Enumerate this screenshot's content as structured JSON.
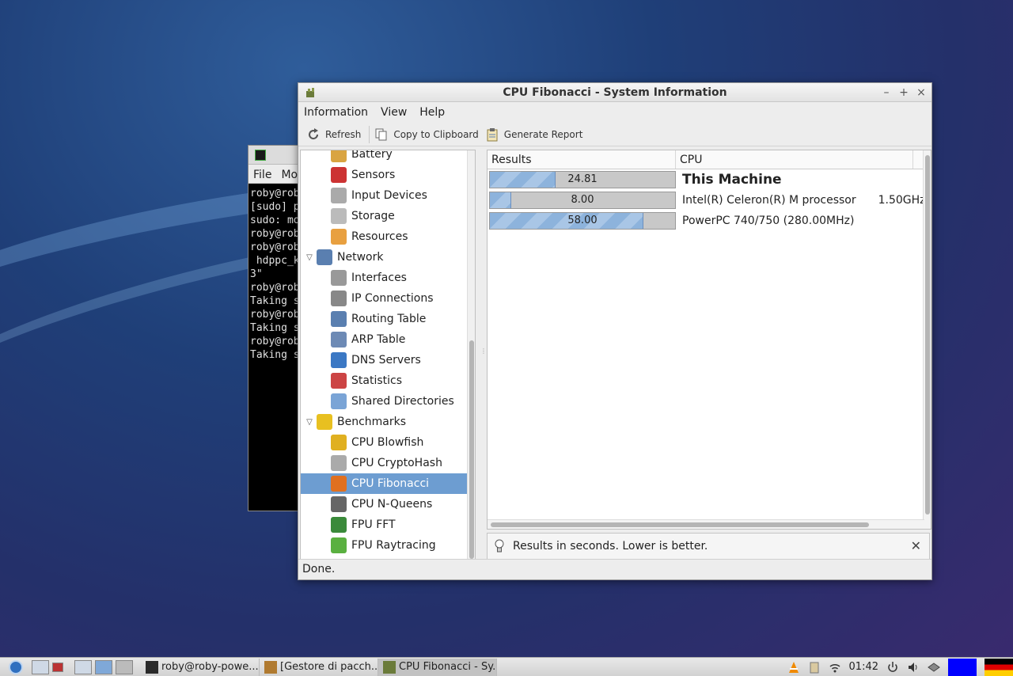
{
  "window": {
    "title": "CPU Fibonacci - System Information",
    "controls": {
      "minimize": "–",
      "maximize": "+",
      "close": "×"
    }
  },
  "menu": [
    "Information",
    "View",
    "Help"
  ],
  "toolbar": {
    "refresh": "Refresh",
    "copy": "Copy to Clipboard",
    "report": "Generate Report"
  },
  "tree": [
    {
      "label": "Battery",
      "type": "child",
      "icon": "battery-icon",
      "color": "#d9a441"
    },
    {
      "label": "Sensors",
      "type": "child",
      "icon": "thermometer-icon",
      "color": "#c33"
    },
    {
      "label": "Input Devices",
      "type": "child",
      "icon": "keyboard-icon",
      "color": "#aaa"
    },
    {
      "label": "Storage",
      "type": "child",
      "icon": "drive-icon",
      "color": "#bbb"
    },
    {
      "label": "Resources",
      "type": "child",
      "icon": "resources-icon",
      "color": "#e8a040"
    },
    {
      "label": "Network",
      "type": "group",
      "icon": "network-icon",
      "color": "#5a7fb0"
    },
    {
      "label": "Interfaces",
      "type": "child",
      "icon": "interfaces-icon",
      "color": "#999"
    },
    {
      "label": "IP Connections",
      "type": "child",
      "icon": "plug-icon",
      "color": "#888"
    },
    {
      "label": "Routing Table",
      "type": "child",
      "icon": "routing-icon",
      "color": "#5a7fb0"
    },
    {
      "label": "ARP Table",
      "type": "child",
      "icon": "arp-icon",
      "color": "#6d8ab5"
    },
    {
      "label": "DNS Servers",
      "type": "child",
      "icon": "globe-icon",
      "color": "#3b78c4"
    },
    {
      "label": "Statistics",
      "type": "child",
      "icon": "statistics-icon",
      "color": "#c44"
    },
    {
      "label": "Shared Directories",
      "type": "child",
      "icon": "folder-icon",
      "color": "#7aa4d6"
    },
    {
      "label": "Benchmarks",
      "type": "group",
      "icon": "benchmark-icon",
      "color": "#e8c020"
    },
    {
      "label": "CPU Blowfish",
      "type": "child",
      "icon": "blowfish-icon",
      "color": "#e0b020"
    },
    {
      "label": "CPU CryptoHash",
      "type": "child",
      "icon": "keys-icon",
      "color": "#aaa"
    },
    {
      "label": "CPU Fibonacci",
      "type": "child",
      "icon": "snail-icon",
      "color": "#e07020",
      "selected": true
    },
    {
      "label": "CPU N-Queens",
      "type": "child",
      "icon": "chess-queen-icon",
      "color": "#666"
    },
    {
      "label": "FPU FFT",
      "type": "child",
      "icon": "fft-icon",
      "color": "#3a8a3a"
    },
    {
      "label": "FPU Raytracing",
      "type": "child",
      "icon": "raytracing-icon",
      "color": "#5ab040"
    }
  ],
  "results": {
    "headers": {
      "results": "Results",
      "cpu": "CPU"
    },
    "bar_max": 70,
    "rows": [
      {
        "value": 24.81,
        "label": "24.81",
        "cpu": "This Machine",
        "freq": "",
        "bold": true
      },
      {
        "value": 8.0,
        "label": "8.00",
        "cpu": "Intel(R) Celeron(R) M processor",
        "freq": "1.50GHz",
        "bold": false
      },
      {
        "value": 58.0,
        "label": "58.00",
        "cpu": "PowerPC 740/750 (280.00MHz)",
        "freq": "",
        "bold": false
      }
    ]
  },
  "note": "Results in seconds. Lower is better.",
  "status": "Done.",
  "terminal": {
    "menu": [
      "File",
      "Mo"
    ],
    "lines": [
      "roby@rob",
      "[sudo] p",
      "sudo: mo",
      "roby@rob",
      "roby@rob",
      " hdppc_k",
      "3\"",
      "roby@rob",
      "Taking s",
      "roby@rob",
      "Taking s",
      "roby@rob",
      "Taking s"
    ]
  },
  "taskbar": {
    "tasks": [
      {
        "label": "roby@roby-powe...",
        "icon": "terminal-icon",
        "active": false
      },
      {
        "label": "[Gestore di pacch...",
        "icon": "package-manager-icon",
        "active": false
      },
      {
        "label": "CPU Fibonacci - Sy...",
        "icon": "sysinfo-icon",
        "active": true
      }
    ],
    "clock": "01:42"
  }
}
